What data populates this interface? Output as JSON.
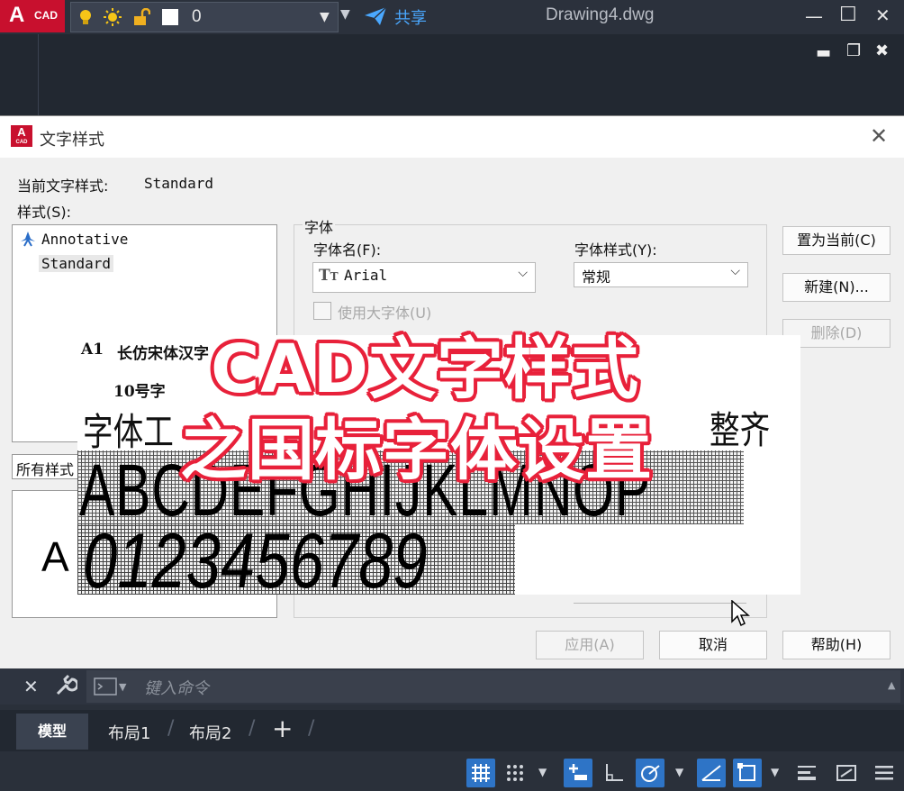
{
  "app": {
    "logo_letter": "A",
    "logo_text": "CAD",
    "layer_value": "0",
    "share_label": "共享",
    "doc_title": "Drawing4.dwg",
    "accent": "#c8102e",
    "share_color": "#4aa8ff"
  },
  "window_controls": {
    "minimize": "—",
    "maximize": "☐",
    "close": "✕"
  },
  "doc_controls": {
    "minimize": "▬",
    "restore": "❐",
    "close": "✖"
  },
  "dialog": {
    "title": "文字样式",
    "current_style_label": "当前文字样式:",
    "current_style_value": "Standard",
    "styles_label": "样式(S):",
    "styles": [
      {
        "name": "Annotative",
        "icon": "annotative-icon"
      },
      {
        "name": "Standard",
        "selected": true
      }
    ],
    "filter_value": "所有样式",
    "preview_text": "A",
    "font_group_label": "字体",
    "font_name_label": "字体名(F):",
    "font_name_value": "Arial",
    "font_style_label": "字体样式(Y):",
    "font_style_value": "常规",
    "use_big_font_label": "使用大字体(U)",
    "buttons": {
      "set_current": "置为当前(C)",
      "new": "新建(N)...",
      "delete": "删除(D)",
      "apply": "应用(A)",
      "cancel": "取消",
      "help": "帮助(H)"
    }
  },
  "overlay_image": {
    "sheet_label": "A1",
    "sample_title": "长仿宋体汉字",
    "size_label": "10号字",
    "sample_chars_left": "字体工",
    "sample_chars_right": "整齐",
    "uppercase_sample": "ABCDEFGHIJKLMNOP",
    "digits_sample": "0123456789"
  },
  "headline": {
    "line1": "CAD文字样式",
    "line2": "之国标字体设置",
    "stroke_color": "#e8213a"
  },
  "command_line": {
    "placeholder": "键入命令"
  },
  "layout_tabs": [
    "模型",
    "布局1",
    "布局2"
  ],
  "add_tab": "+"
}
